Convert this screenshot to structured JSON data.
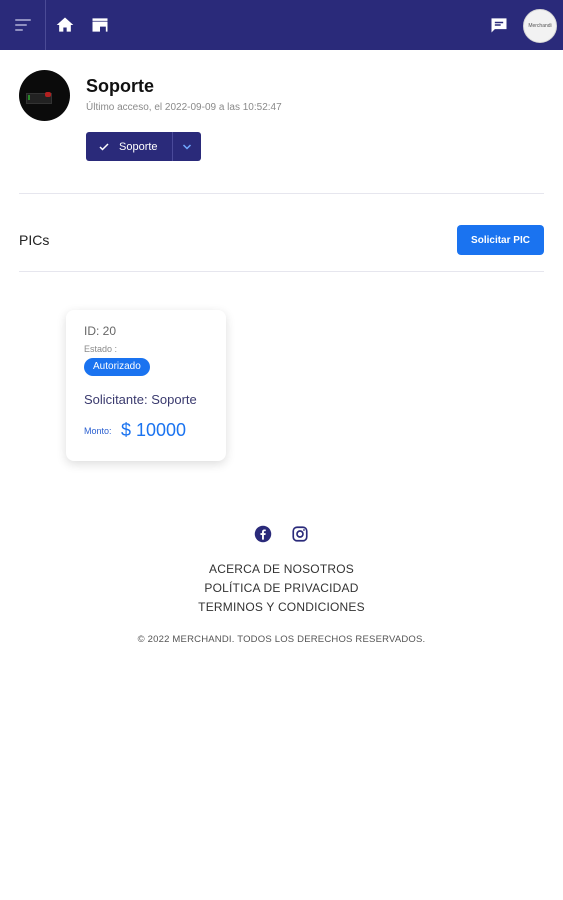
{
  "topbar": {
    "menu_icon": "hamburger-menu-icon",
    "icons": [
      "home-icon",
      "store-icon",
      "chat-icon"
    ],
    "avatar_text": "Merchandi"
  },
  "profile": {
    "name": "Soporte",
    "last_access": "Último acceso, el 2022-09-09 a las 10:52:47",
    "role_button": "Soporte"
  },
  "pics": {
    "title": "PICs",
    "request_button": "Solicitar PIC"
  },
  "card": {
    "id": "ID: 20",
    "estado_label": "Estado :",
    "status_badge": "Autorizado",
    "solicitante": "Solicitante: Soporte",
    "monto_label": "Monto:",
    "monto_value": "$ 10000"
  },
  "footer": {
    "social_icons": [
      "facebook-icon",
      "instagram-icon"
    ],
    "links": [
      "ACERCA DE NOSOTROS",
      "POLÍTICA DE PRIVACIDAD",
      "TERMINOS Y CONDICIONES"
    ],
    "copyright": "© 2022 MERCHANDI. TODOS LOS DERECHOS RESERVADOS."
  },
  "colors": {
    "header": "#2a2a7a",
    "accent": "#1a73f0"
  }
}
